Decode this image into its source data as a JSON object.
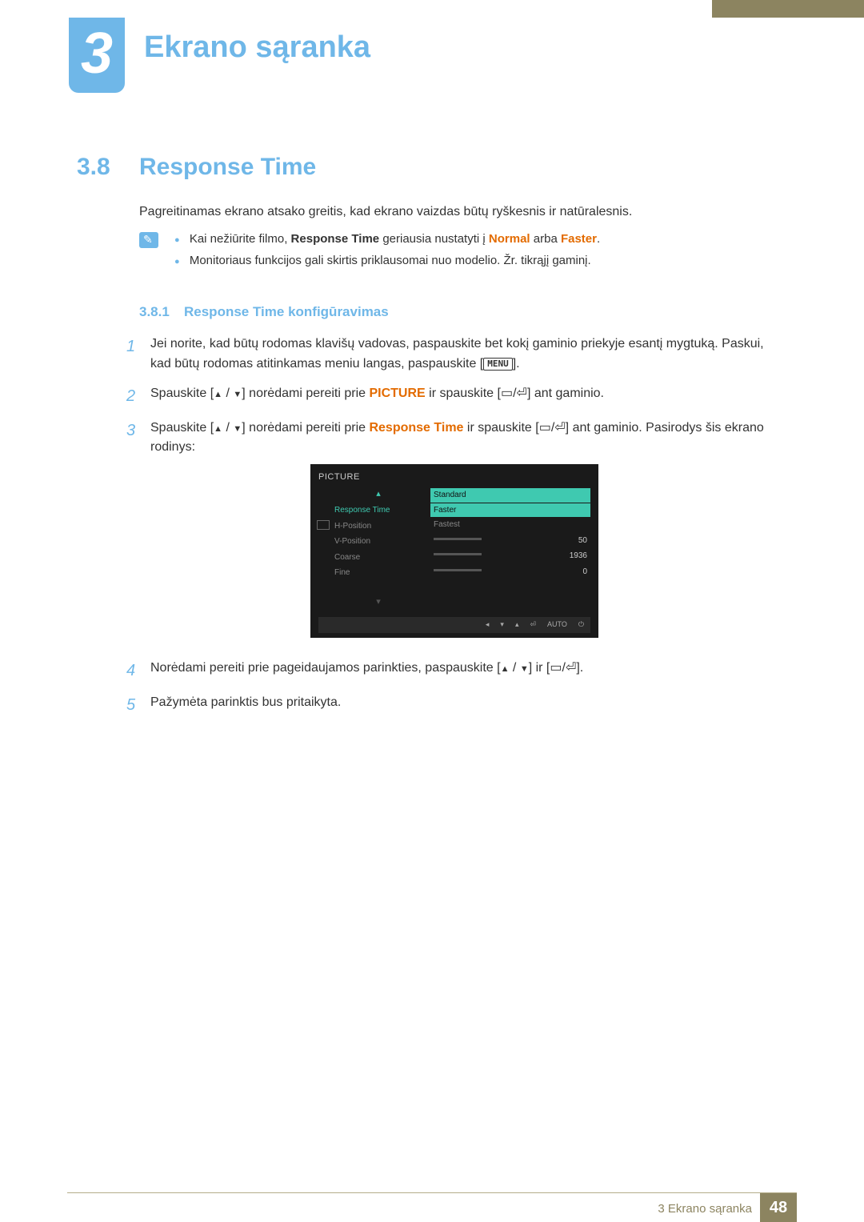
{
  "chapter": {
    "number": "3",
    "title": "Ekrano sąranka"
  },
  "section": {
    "number": "3.8",
    "title": "Response Time"
  },
  "intro": "Pagreitinamas ekrano atsako greitis, kad ekrano vaizdas būtų ryškesnis ir natūralesnis.",
  "notes": {
    "n1_a": "Kai nežiūrite filmo, ",
    "n1_b": "Response Time",
    "n1_c": " geriausia nustatyti į ",
    "n1_d": "Normal",
    "n1_e": " arba ",
    "n1_f": "Faster",
    "n1_g": ".",
    "n2": "Monitoriaus funkcijos gali skirtis priklausomai nuo modelio. Žr. tikrąjį gaminį."
  },
  "subsection": {
    "number": "3.8.1",
    "title": "Response Time konfigūravimas"
  },
  "steps": {
    "s1a": "Jei norite, kad būtų rodomas klavišų vadovas, paspauskite bet kokį gaminio priekyje esantį mygtuką. Paskui, kad būtų rodomas atitinkamas meniu langas, paspauskite [",
    "s1b": "].",
    "s2a": "Spauskite [",
    "s2b": "] norėdami pereiti prie ",
    "s2c": "PICTURE",
    "s2d": " ir spauskite [",
    "s2e": "] ant gaminio.",
    "s3a": "Spauskite [",
    "s3b": "] norėdami pereiti prie ",
    "s3c": "Response Time",
    "s3d": " ir spauskite [",
    "s3e": "] ant gaminio. Pasirodys šis ekrano rodinys:",
    "s4a": "Norėdami pereiti prie pageidaujamos parinkties, paspauskite [",
    "s4b": "] ir [",
    "s4c": "].",
    "s5": "Pažymėta parinktis bus pritaikyta."
  },
  "menu_label": "MENU",
  "osd": {
    "title": "PICTURE",
    "items": [
      "Response Time",
      "H-Position",
      "V-Position",
      "Coarse",
      "Fine"
    ],
    "options": [
      "Standard",
      "Faster",
      "Fastest"
    ],
    "hpos": "50",
    "coarse": "1936",
    "fine": "0",
    "auto": "AUTO"
  },
  "footer": {
    "text": "3 Ekrano sąranka",
    "page": "48"
  }
}
